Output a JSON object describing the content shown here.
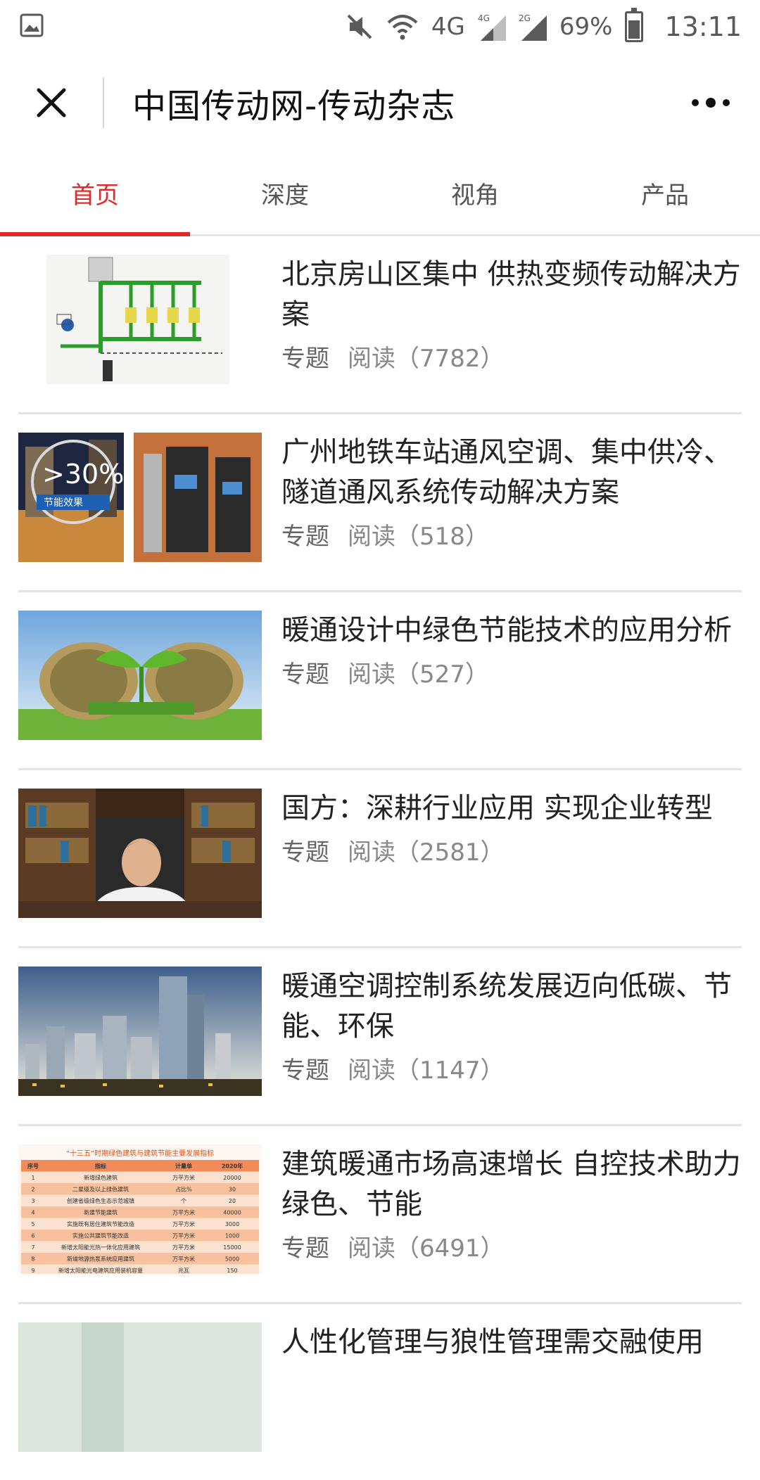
{
  "status": {
    "network": "4G",
    "net_4g": "4G",
    "net_2g": "2G",
    "battery": "69%",
    "battery_level": 0.69,
    "time": "13:11"
  },
  "header": {
    "title": "中国传动网-传动杂志"
  },
  "tabs": [
    {
      "label": "首页",
      "active": true
    },
    {
      "label": "深度",
      "active": false
    },
    {
      "label": "视角",
      "active": false
    },
    {
      "label": "产品",
      "active": false
    }
  ],
  "colors": {
    "accent": "#e02929",
    "text": "#222222",
    "meta": "#888888"
  },
  "articles": [
    {
      "title": "北京房山区集中 供热变频传动解决方案",
      "tag": "专题",
      "views": "阅读（7782）",
      "thumb": "schematic-diagram"
    },
    {
      "title": "广州地铁车站通风空调、集中供冷、隧道通风系统传动解决方案",
      "tag": "专题",
      "views": "阅读（518）",
      "thumb": "drive-photo",
      "thumb_text": ">30%",
      "thumb_caption": "节能效果"
    },
    {
      "title": "暖通设计中绿色节能技术的应用分析",
      "tag": "专题",
      "views": "阅读（527）",
      "thumb": "green-sprout"
    },
    {
      "title": "国方：深耕行业应用 实现企业转型",
      "tag": "专题",
      "views": "阅读（2581）",
      "thumb": "office-portrait"
    },
    {
      "title": "暖通空调控制系统发展迈向低碳、节能、环保",
      "tag": "专题",
      "views": "阅读（1147）",
      "thumb": "city-skyline"
    },
    {
      "title": "建筑暖通市场高速增长 自控技术助力绿色、节能",
      "tag": "专题",
      "views": "阅读（6491）",
      "thumb": "data-table",
      "thumb_title": "“十三五”时期绿色建筑与建筑节能主要发展指标",
      "table_head": [
        "序号",
        "指标",
        "计量单",
        "2020年"
      ],
      "table_rows": [
        [
          "1",
          "新增绿色建筑",
          "万平方米",
          "20000"
        ],
        [
          "2",
          "二星级及以上绿色建筑",
          "占比%",
          "30"
        ],
        [
          "3",
          "创建省级绿色生态示范城镇",
          "个",
          "20"
        ],
        [
          "4",
          "新建节能建筑",
          "万平方米",
          "40000"
        ],
        [
          "5",
          "实施既有居住建筑节能改造",
          "万平方米",
          "3000"
        ],
        [
          "6",
          "实施公共建筑节能改造",
          "万平方米",
          "1000"
        ],
        [
          "7",
          "新增太阳能光热一体化应用建筑",
          "万平方米",
          "15000"
        ],
        [
          "8",
          "新增地源热泵系统应用建筑",
          "万平方米",
          "5000"
        ],
        [
          "9",
          "新增太阳能光电建筑应用装机容量",
          "兆瓦",
          "150"
        ]
      ]
    },
    {
      "title": "人性化管理与狼性管理需交融使用",
      "tag": "",
      "views": "",
      "thumb": "partial"
    }
  ]
}
